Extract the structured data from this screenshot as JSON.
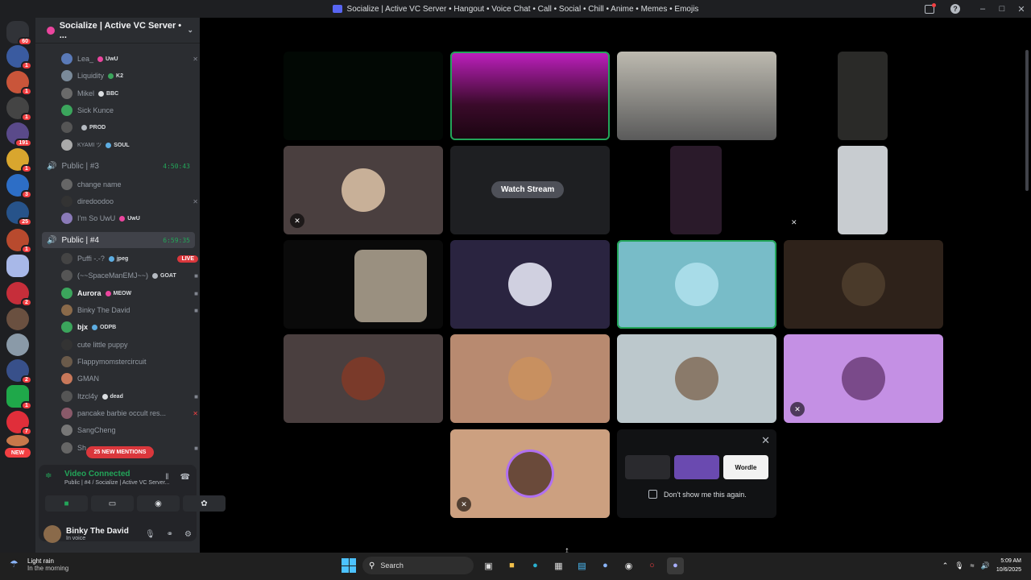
{
  "window": {
    "title": "Socialize | Active VC Server • Hangout • Voice Chat • Call • Social • Chill • Anime • Memes • Emojis"
  },
  "guilds": {
    "badges": [
      "60",
      "1",
      "1",
      "1",
      "191",
      "1",
      "3",
      "25",
      "1",
      "2",
      "1",
      "2",
      "1",
      "7"
    ],
    "new_label": "NEW"
  },
  "server": {
    "name": "Socialize | Active VC Server • ..."
  },
  "top_users": [
    {
      "name": "Lea_",
      "tag": "UwU",
      "tag_color": "#eb459e"
    },
    {
      "name": "Liquidity",
      "tag": "K2",
      "tag_color": "#3ba55c"
    },
    {
      "name": "Mikel",
      "tag": "BBC",
      "tag_color": "#dbdee1"
    },
    {
      "name": "Sick Kunce",
      "tag": "",
      "tag_color": ""
    },
    {
      "name": "",
      "tag": "PROD",
      "tag_color": "#b5bac1"
    },
    {
      "name": "KYAMI ツ",
      "tag": "SOUL",
      "tag_color": "#5dade2"
    }
  ],
  "channel3": {
    "name": "Public | #3",
    "time": "4:50:43",
    "users": [
      {
        "name": "change name"
      },
      {
        "name": "diredoodoo"
      },
      {
        "name": "I'm So UwU",
        "tag": "UwU"
      }
    ]
  },
  "channel4": {
    "name": "Public | #4",
    "time": "6:59:35",
    "users": [
      {
        "name": "Puffi -.-?",
        "tag": "jpeg",
        "live": "LIVE"
      },
      {
        "name": "(~~SpaceManEMJ~~)",
        "tag": "GOAT"
      },
      {
        "name": "Aurora",
        "tag": "MEOW"
      },
      {
        "name": "Binky The David"
      },
      {
        "name": "bjx",
        "tag": "ODPB"
      },
      {
        "name": "cute little puppy"
      },
      {
        "name": "Flappymomstercircuit"
      },
      {
        "name": "GMAN"
      },
      {
        "name": "Itzcl4y",
        "tag": "dead"
      },
      {
        "name": "pancake barbie occult res..."
      },
      {
        "name": "SangCheng"
      },
      {
        "name": "Sh..."
      }
    ]
  },
  "mentions": "25 NEW MENTIONS",
  "voice_panel": {
    "status": "Video Connected",
    "location": "Public | #4 / Socialize | Active VC Server..."
  },
  "user_panel": {
    "name": "Binky The David",
    "status": "In voice"
  },
  "grid": {
    "watch_stream": "Watch Stream"
  },
  "promo": {
    "card3": "Wordle",
    "checkbox_label": "Don't show me this again."
  },
  "taskbar": {
    "weather_title": "Light rain",
    "weather_sub": "In the morning",
    "search": "Search",
    "time": "5:09 AM",
    "date": "10/6/2025"
  }
}
